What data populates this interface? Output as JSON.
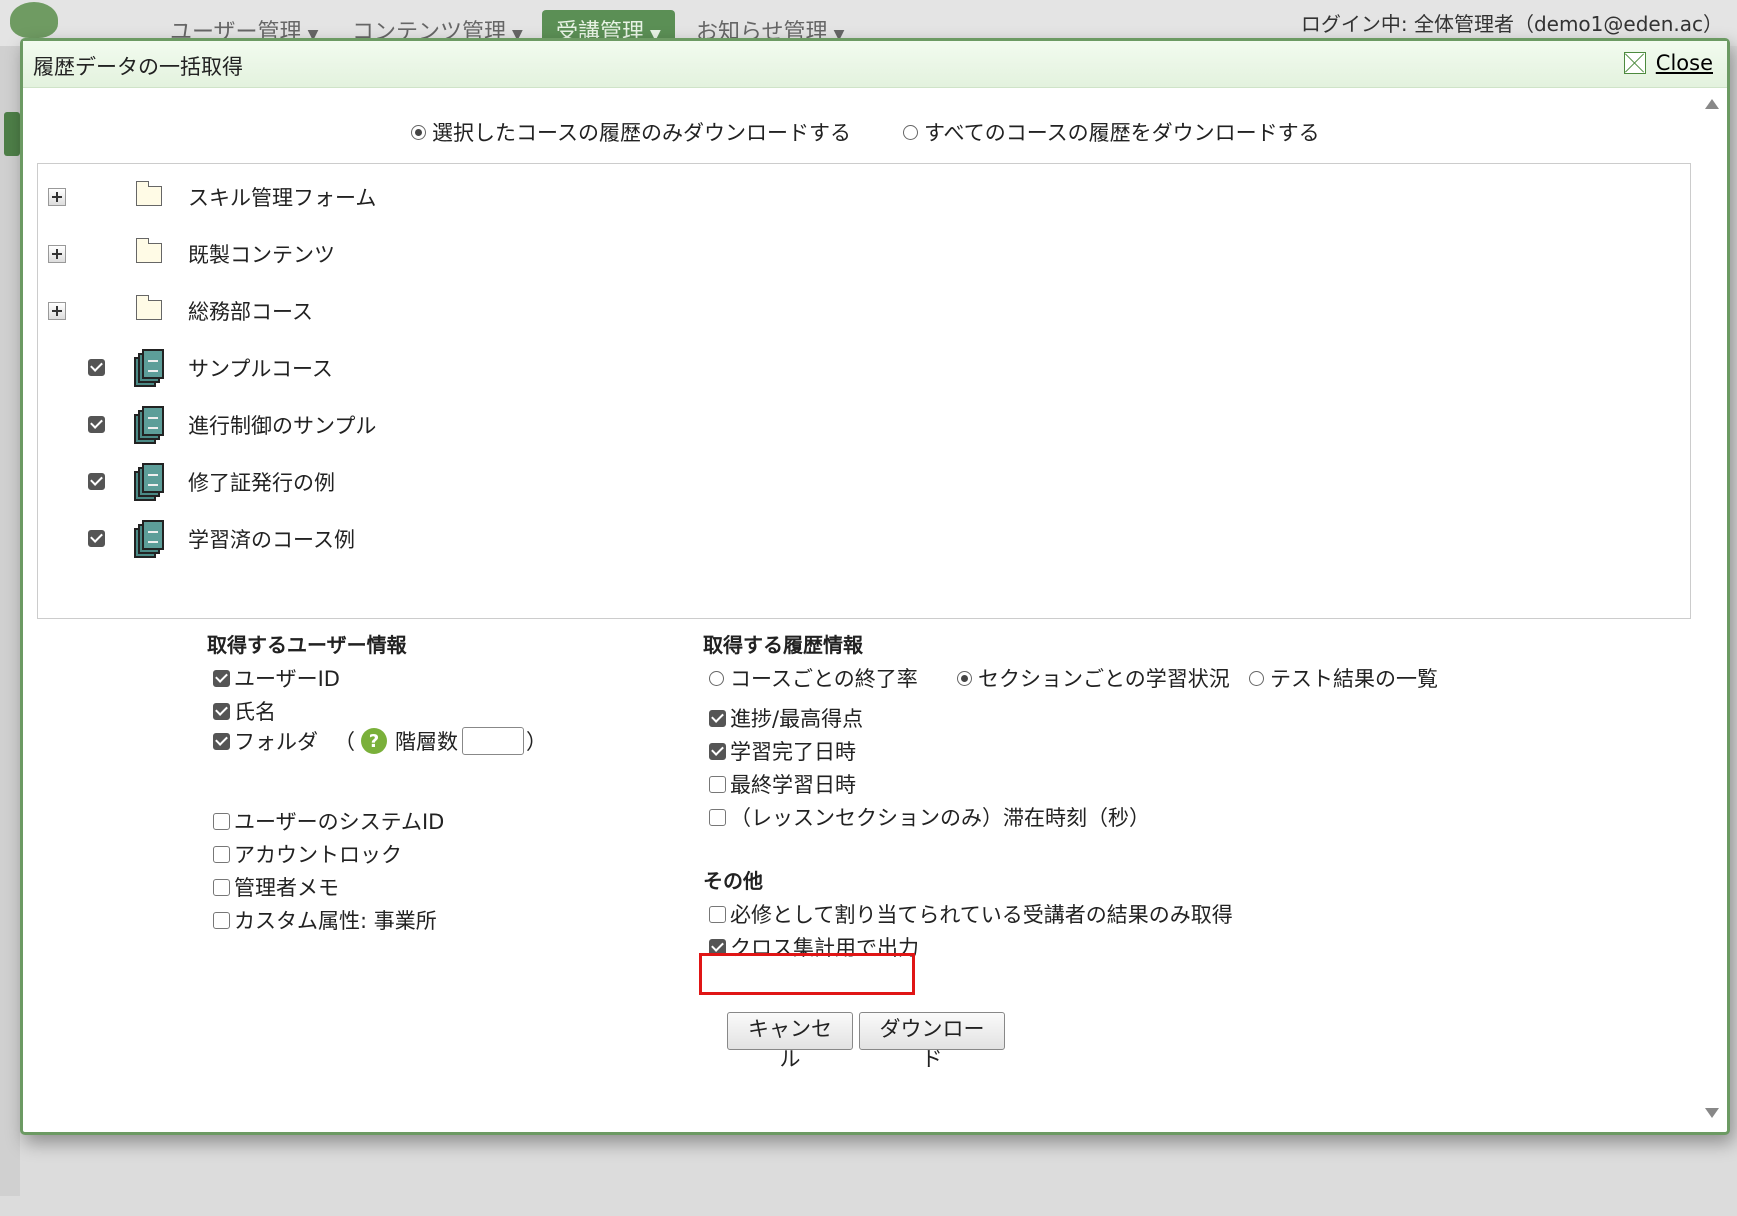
{
  "background": {
    "nav": [
      "ユーザー管理",
      "コンテンツ管理",
      "受講管理",
      "お知らせ管理"
    ],
    "login": "ログイン中: 全体管理者（demo1@eden.ac）"
  },
  "dialog": {
    "title": "履歴データの一括取得",
    "close_label": "Close"
  },
  "mode": {
    "selected_only": "選択したコースの履歴のみダウンロードする",
    "all_courses": "すべてのコースの履歴をダウンロードする",
    "selected": "selected_only"
  },
  "tree": [
    {
      "type": "folder",
      "label": "スキル管理フォーム"
    },
    {
      "type": "folder",
      "label": "既製コンテンツ"
    },
    {
      "type": "folder",
      "label": "総務部コース"
    },
    {
      "type": "course",
      "label": "サンプルコース",
      "checked": true
    },
    {
      "type": "course",
      "label": "進行制御のサンプル",
      "checked": true
    },
    {
      "type": "course",
      "label": "修了証発行の例",
      "checked": true
    },
    {
      "type": "course",
      "label": "学習済のコース例",
      "checked": true
    }
  ],
  "user_info": {
    "heading": "取得するユーザー情報",
    "items": [
      {
        "label": "ユーザーID",
        "checked": true
      },
      {
        "label": "氏名",
        "checked": true
      },
      {
        "label": "フォルダ",
        "checked": true
      },
      {
        "label": "ユーザーのシステムID",
        "checked": false
      },
      {
        "label": "アカウントロック",
        "checked": false
      },
      {
        "label": "管理者メモ",
        "checked": false
      },
      {
        "label": "カスタム属性: 事業所",
        "checked": false
      }
    ],
    "folder_open": "（",
    "folder_depth_label": "階層数",
    "folder_close": "）",
    "folder_depth_value": ""
  },
  "history_info": {
    "heading": "取得する履歴情報",
    "radios": [
      {
        "label": "コースごとの終了率",
        "selected": false
      },
      {
        "label": "セクションごとの学習状況",
        "selected": true
      },
      {
        "label": "テスト結果の一覧",
        "selected": false
      }
    ],
    "items": [
      {
        "label": "進捗/最高得点",
        "checked": true
      },
      {
        "label": "学習完了日時",
        "checked": true
      },
      {
        "label": "最終学習日時",
        "checked": false
      },
      {
        "label": "（レッスンセクションのみ）滞在時刻（秒）",
        "checked": false
      }
    ]
  },
  "other": {
    "heading": "その他",
    "items": [
      {
        "label": "必修として割り当てられている受講者の結果のみ取得",
        "checked": false
      },
      {
        "label": "クロス集計用で出力",
        "checked": true
      }
    ]
  },
  "buttons": {
    "cancel": "キャンセル",
    "download": "ダウンロード"
  },
  "colors": {
    "dialog_border": "#6c9a63",
    "highlight": "#e01515",
    "course_icon": "#4b8a86"
  }
}
